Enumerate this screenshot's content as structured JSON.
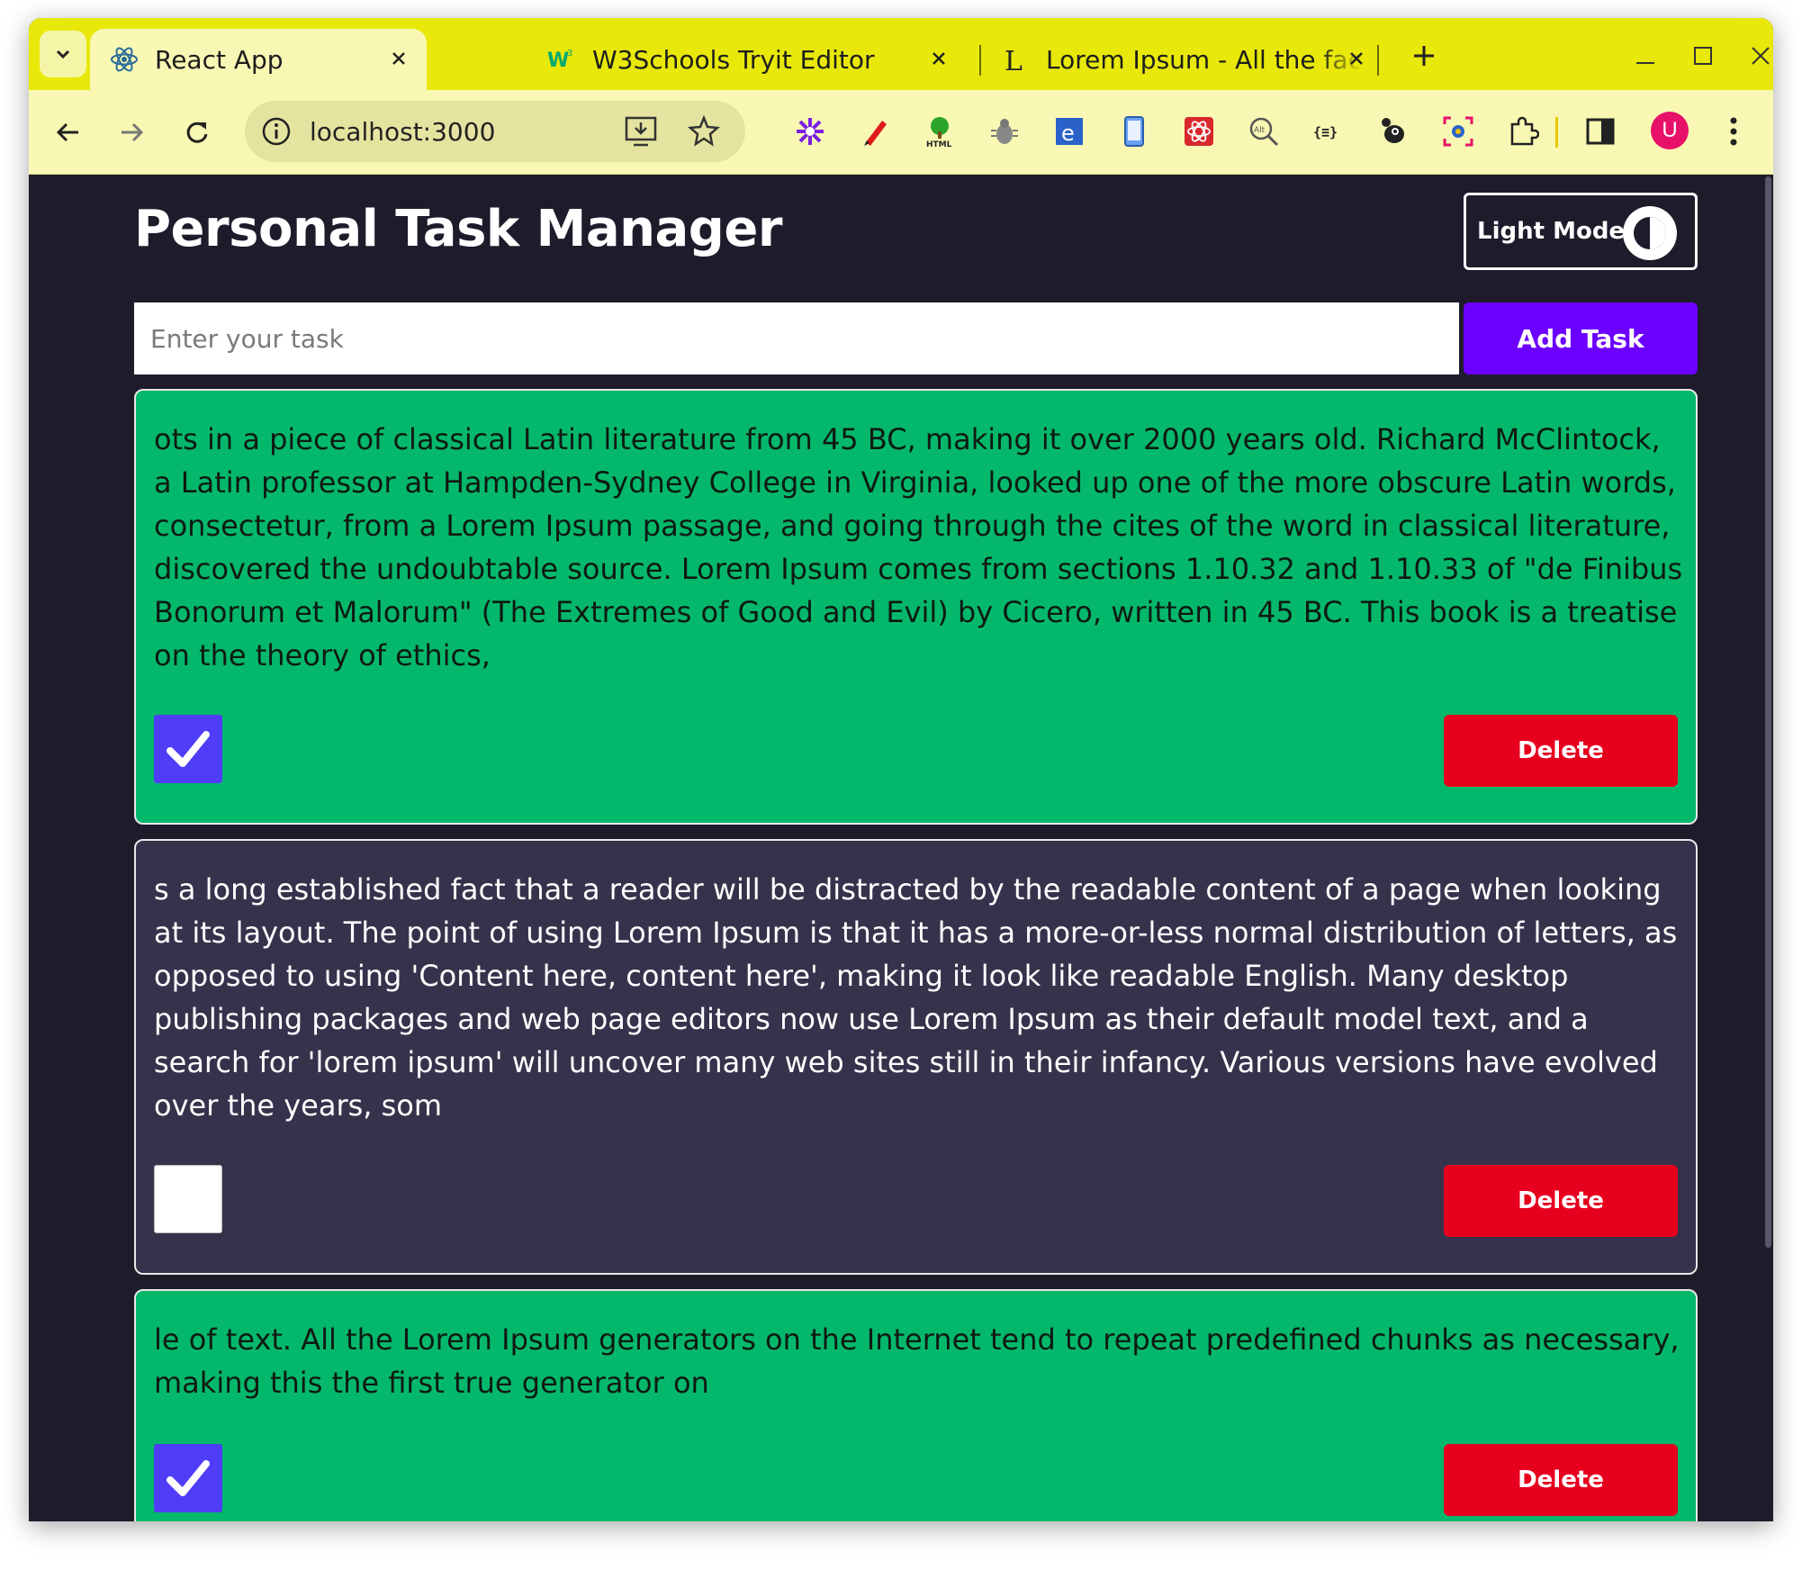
{
  "browser": {
    "tabs": [
      {
        "title": "React App",
        "icon": "react-icon",
        "active": true
      },
      {
        "title": "W3Schools Tryit Editor",
        "icon": "w3schools-icon",
        "active": false
      },
      {
        "title": "Lorem Ipsum - All the fac",
        "icon": "lorem-ipsum-icon",
        "active": false
      }
    ],
    "url": "localhost:3000",
    "profile_initial": "U"
  },
  "app": {
    "title": "Personal Task Manager",
    "mode_toggle_label": "Light Mode",
    "input_placeholder": "Enter your task",
    "add_button_label": "Add Task",
    "tasks": [
      {
        "text": "ots in a piece of classical Latin literature from 45 BC, making it over 2000 years old. Richard McClintock, a Latin professor at Hampden-Sydney College in Virginia, looked up one of the more obscure Latin words, consectetur, from a Lorem Ipsum passage, and going through the cites of the word in classical literature, discovered the undoubtable source. Lorem Ipsum comes from sections 1.10.32 and 1.10.33 of \"de Finibus Bonorum et Malorum\" (The Extremes of Good and Evil) by Cicero, written in 45 BC. This book is a treatise on the theory of ethics,",
        "completed": true,
        "delete_label": "Delete"
      },
      {
        "text": "s a long established fact that a reader will be distracted by the readable content of a page when looking at its layout. The point of using Lorem Ipsum is that it has a more-or-less normal distribution of letters, as opposed to using 'Content here, content here', making it look like readable English. Many desktop publishing packages and web page editors now use Lorem Ipsum as their default model text, and a search for 'lorem ipsum' will uncover many web sites still in their infancy. Various versions have evolved over the years, som",
        "completed": false,
        "delete_label": "Delete"
      },
      {
        "text": "le of text. All the Lorem Ipsum generators on the Internet tend to repeat predefined chunks as necessary, making this the first true generator on",
        "completed": true,
        "delete_label": "Delete"
      }
    ]
  },
  "colors": {
    "tab_strip": "#e8e80a",
    "toolbar": "#f8f8b4",
    "app_bg": "#1e1c2b",
    "completed_card": "#04b86b",
    "pending_card": "#37324c",
    "add_button": "#6c00ff",
    "delete_button": "#e6001e",
    "checkbox_checked": "#4f3df7"
  }
}
